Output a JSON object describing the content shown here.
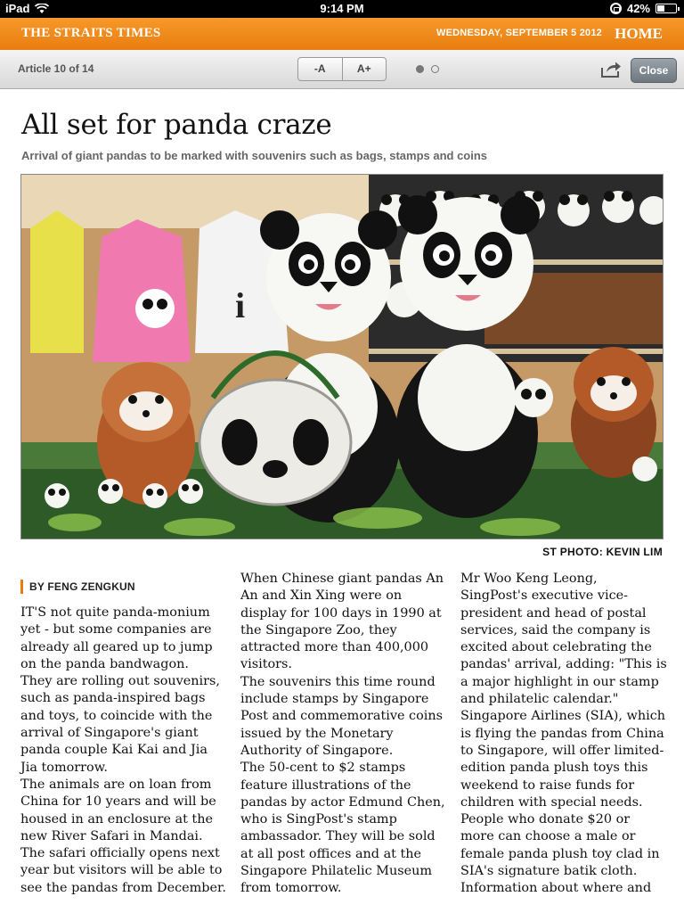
{
  "status_bar": {
    "device": "iPad",
    "time": "9:14 PM",
    "battery_percent": "42%",
    "battery_level": 0.42
  },
  "masthead": {
    "brand": "THE STRAITS TIMES",
    "date": "WEDNESDAY, SEPTEMBER 5 2012",
    "home_label": "HOME",
    "color": "#ea7d10"
  },
  "toolbar": {
    "article_count": "Article 10 of 14",
    "font_decrease_label": "-A",
    "font_increase_label": "A+",
    "page_dots": 2,
    "active_dot": 1,
    "share_icon": "share-icon",
    "close_label": "Close"
  },
  "article": {
    "headline": "All set for panda craze",
    "standfirst": "Arrival of giant pandas to be marked with souvenirs such as bags, stamps and coins",
    "photo_credit": "ST PHOTO: KEVIN LIM",
    "byline": "BY FENG ZENGKUN",
    "columns": [
      [
        "IT'S not quite panda-monium yet - but some companies are already all geared up to jump on the panda bandwagon.",
        " They are rolling out souvenirs, such as panda-inspired bags and toys, to coincide with the arrival of Singapore's giant panda couple Kai Kai and Jia Jia tomorrow.",
        " The animals are on loan from China for 10 years and will be housed in an enclosure at the new River Safari in Mandai. The safari officially opens next year but visitors will be able to see the pandas from December."
      ],
      [
        " When Chinese giant pandas An An and Xin Xing were on display for 100 days in 1990 at the Singapore Zoo, they attracted more than 400,000 visitors.",
        " The souvenirs this time round include stamps by Singapore Post and commemorative coins issued by the Monetary Authority of Singapore.",
        " The 50-cent to $2 stamps feature illustrations of the pandas by actor Edmund Chen, who is SingPost's stamp ambassador. They will be sold at all post offices and at the Singapore Philatelic Museum from tomorrow."
      ],
      [
        " Mr Woo Keng Leong, SingPost's executive vice-president and head of postal services, said the company is excited about celebrating the pandas' arrival, adding: \"This is a major highlight in our stamp and philatelic calendar.\"",
        " Singapore Airlines (SIA), which is flying the pandas from China to Singapore, will offer limited-edition panda plush toys this weekend to raise funds for children with special needs.",
        " People who donate $20 or more can choose a male or female panda plush toy clad in SIA's signature batik cloth.",
        " Information about where and"
      ]
    ]
  }
}
